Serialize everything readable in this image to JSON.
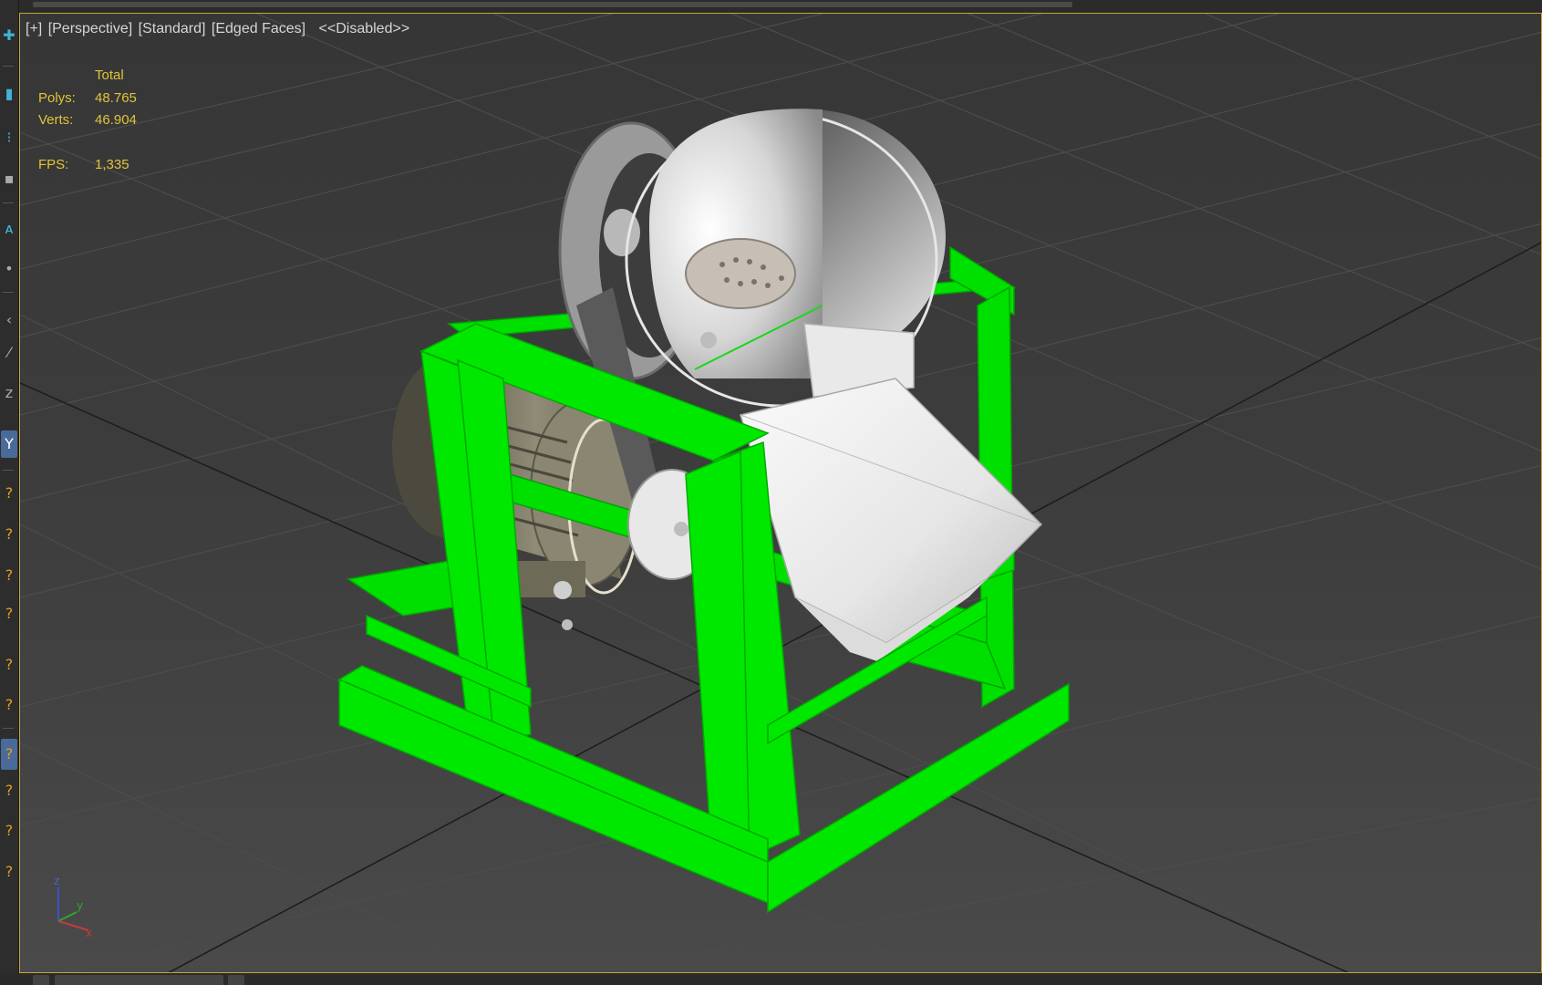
{
  "viewport": {
    "labels": {
      "plus": "[+]",
      "view": "[Perspective]",
      "shading": "[Standard]",
      "edges": "[Edged Faces]",
      "state": "<<Disabled>>"
    },
    "stats": {
      "header": "Total",
      "polys_label": "Polys:",
      "polys_value": "48.765",
      "verts_label": "Verts:",
      "verts_value": "46.904",
      "fps_label": "FPS:",
      "fps_value": "1,335"
    },
    "axis_gizmo": {
      "z": "z",
      "y": "y",
      "x": "x"
    }
  },
  "colors": {
    "frame_green": "#00ff00",
    "stats_text": "#e2c33a",
    "viewport_border": "#c9a437",
    "label_text": "#d6d6d6"
  },
  "toolbar_icons": [
    "create-icon",
    "light-icon",
    "spline-icon",
    "particle-icon",
    "helper-icon",
    "text-icon",
    "point-icon",
    "tape-icon",
    "cursor-icon",
    "axis-y-icon",
    "help-icon",
    "help-icon",
    "help-icon",
    "help-icon",
    "help-icon",
    "help-icon",
    "help-icon",
    "help-icon",
    "help-icon",
    "help-icon"
  ]
}
